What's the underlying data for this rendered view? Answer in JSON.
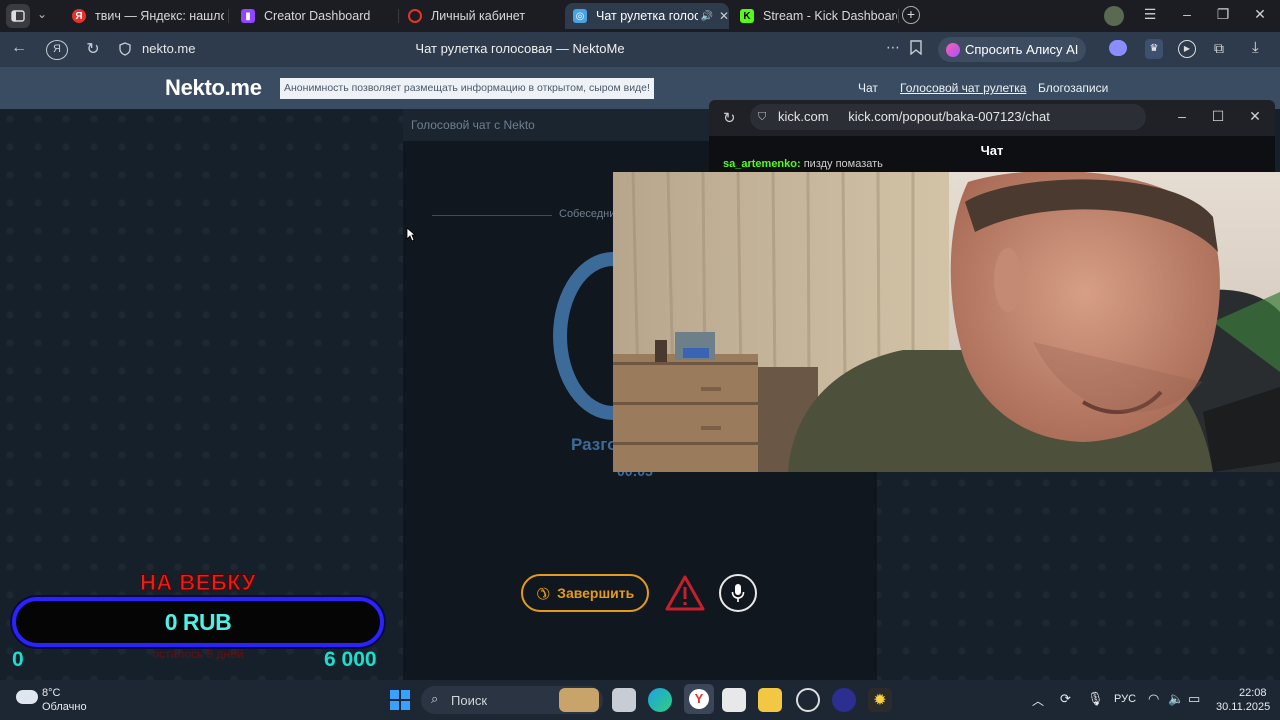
{
  "browser": {
    "tabs": [
      {
        "label": "твич — Яндекс: нашлось",
        "icon": "yandex-search-icon",
        "color": "#e5322d",
        "active": false
      },
      {
        "label": "Creator Dashboard",
        "icon": "twitch-icon",
        "color": "#9146ff",
        "active": false
      },
      {
        "label": "Личный кабинет",
        "icon": "ring-icon",
        "color": "#e5322d",
        "active": false
      },
      {
        "label": "Чат рулетка голосов",
        "icon": "nekto-icon",
        "color": "#4aa3df",
        "active": true
      },
      {
        "label": "Stream - Kick Dashboard",
        "icon": "kick-icon",
        "color": "#53fc18",
        "active": false
      }
    ],
    "address": {
      "domain": "nekto.me",
      "page_title": "Чат рулетка голосовая — NektoMe"
    },
    "alice_button": "Спросить Алису AI"
  },
  "site": {
    "logo": "Nekto.me",
    "tagline": "Анонимность позволяет размещать информацию в открытом, сыром виде!",
    "nav": [
      "Чат",
      "Голосовой чат рулетка",
      "Блогозаписи"
    ],
    "panel_title": "Голосовой чат с Nekto",
    "interlocutor_label": "Собеседни",
    "talk_label": "Разго",
    "timer": "00:05",
    "end_button": "Завершить"
  },
  "popout": {
    "site": "kick.com",
    "url": "kick.com/popout/baka-007123/chat",
    "chat_tab": "Чат",
    "message_user": "sa_artemenko:",
    "message_text": "пизду помазать"
  },
  "overlay": {
    "title": "НА ВЕБКУ",
    "amount": "0 RUB",
    "min": "0",
    "max": "6 000",
    "subtitle": "осталось 8 дней",
    "progress": 0
  },
  "taskbar": {
    "weather_temp": "8°C",
    "weather_desc": "Облачно",
    "search_placeholder": "Поиск",
    "lang": "РУС",
    "time": "22:08",
    "date": "30.11.2025"
  }
}
